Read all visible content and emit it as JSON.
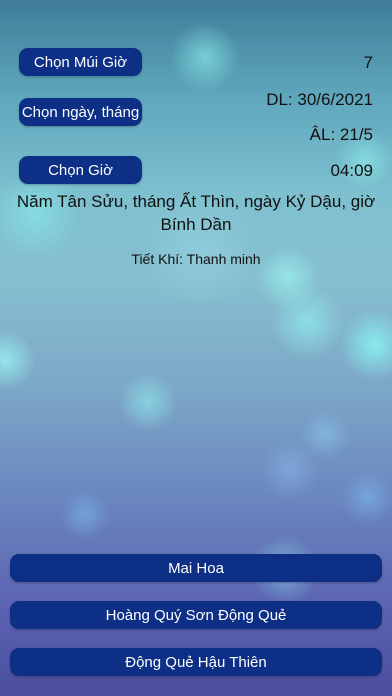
{
  "time_zone": {
    "button_label": "Chọn Múi Giờ",
    "value": "7"
  },
  "date": {
    "button_label": "Chọn ngày, tháng",
    "solar": "DL: 30/6/2021",
    "lunar": "ÂL: 21/5"
  },
  "time": {
    "button_label": "Chọn Giờ",
    "value": "04:09"
  },
  "lunar_description": "Năm Tân Sửu, tháng Ất Thìn, ngày Kỷ Dậu, giờ Bính Dần",
  "solar_term": "Tiết Khí: Thanh minh",
  "methods": [
    {
      "label": "Mai Hoa"
    },
    {
      "label": "Hoàng Quý Sơn Động Quẻ"
    },
    {
      "label": "Động Quẻ Hậu Thiên"
    }
  ],
  "colors": {
    "button_bg": "#0d2f86",
    "button_text": "#ffffff"
  }
}
